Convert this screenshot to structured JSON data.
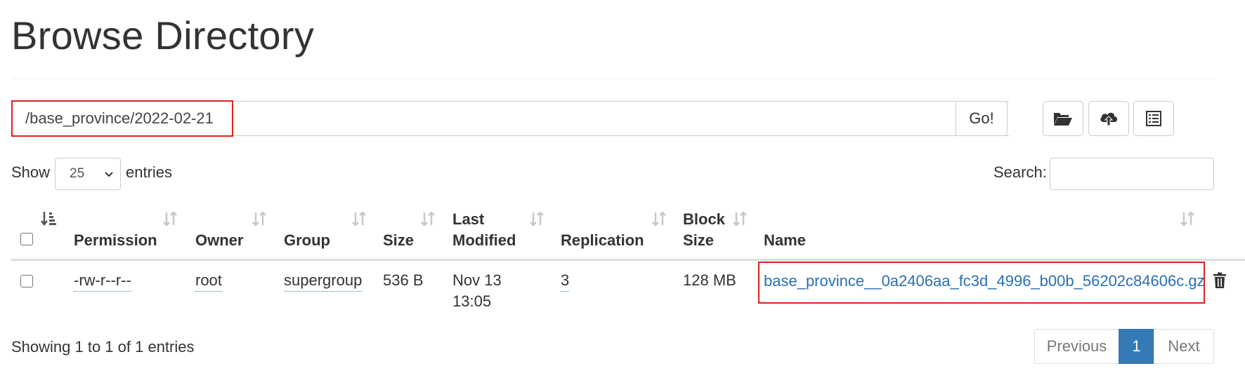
{
  "page_title": "Browse Directory",
  "path_bar": {
    "value": "/base_province/2022-02-21",
    "go_label": "Go!"
  },
  "toolbar": {
    "icons": [
      "folder-open-icon",
      "cloud-upload-icon",
      "list-icon"
    ]
  },
  "length_control": {
    "show_label": "Show",
    "selected": "25",
    "entries_label": "entries"
  },
  "search": {
    "label": "Search:",
    "value": ""
  },
  "table": {
    "columns": [
      "Permission",
      "Owner",
      "Group",
      "Size",
      "Last",
      "Modified",
      "Replication",
      "Block",
      "Size",
      "Name"
    ],
    "rows": [
      {
        "permission": "-rw-r--r--",
        "owner": "root",
        "group": "supergroup",
        "size": "536 B",
        "modified_date": "Nov 13",
        "modified_time": "13:05",
        "replication": "3",
        "block_size": "128 MB",
        "name": "base_province__0a2406aa_fc3d_4996_b00b_56202c84606c.gz"
      }
    ]
  },
  "info_text": "Showing 1 to 1 of 1 entries",
  "pagination": {
    "previous": "Previous",
    "current": "1",
    "next": "Next"
  },
  "colors": {
    "accent": "#337ab7",
    "link": "#2a6fb5",
    "highlight": "#e02020"
  }
}
